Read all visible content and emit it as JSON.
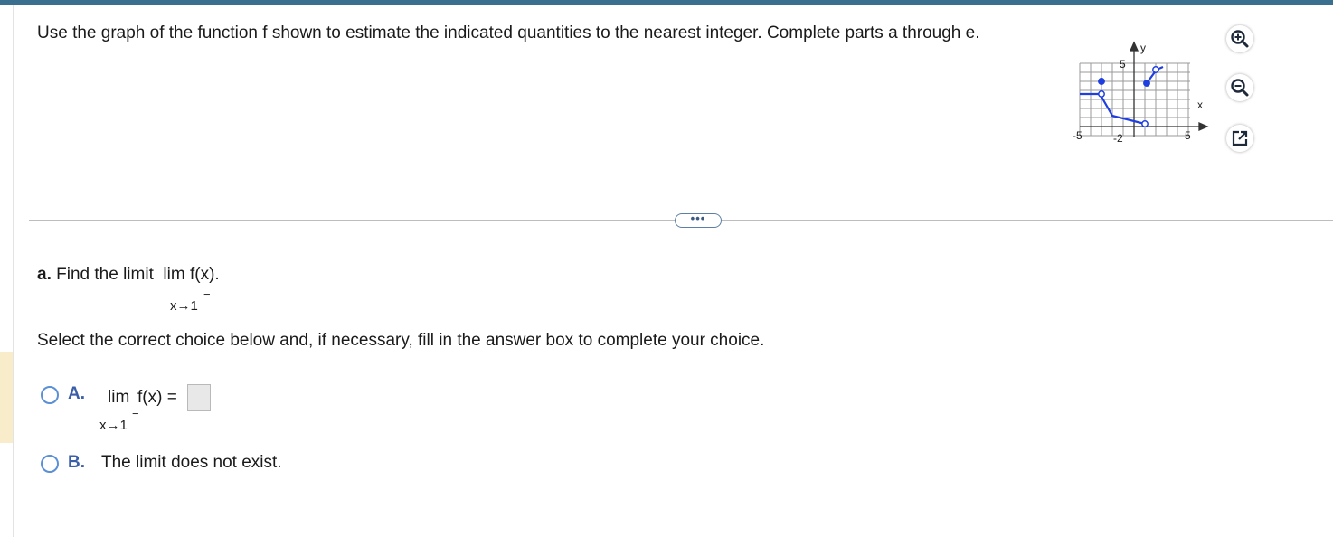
{
  "question": {
    "text": "Use the graph of the function f shown to estimate the indicated quantities to the nearest integer. Complete parts a through e."
  },
  "graph": {
    "y_axis_label": "y",
    "x_axis_label": "x",
    "tick_labels": {
      "y_top": "5",
      "y_bottom": "-2",
      "x_left": "-5",
      "x_right": "5"
    },
    "curve_color": "#1f3fe0"
  },
  "tools": {
    "zoom_in": "zoom-in",
    "zoom_out": "zoom-out",
    "popout": "popout"
  },
  "divider": {
    "more_label": "•••"
  },
  "part_a": {
    "label": "a.",
    "text": "Find the limit",
    "lim": "lim",
    "func": "f(x).",
    "subscript": "x→1",
    "superscript": "−"
  },
  "instruction": "Select the correct choice below and, if necessary, fill in the answer box to complete your choice.",
  "choices": {
    "a": {
      "letter": "A.",
      "lim": "lim",
      "func": "f(x) =",
      "subscript": "x→1",
      "superscript": "−",
      "answer_value": ""
    },
    "b": {
      "letter": "B.",
      "text": "The limit does not exist."
    }
  }
}
